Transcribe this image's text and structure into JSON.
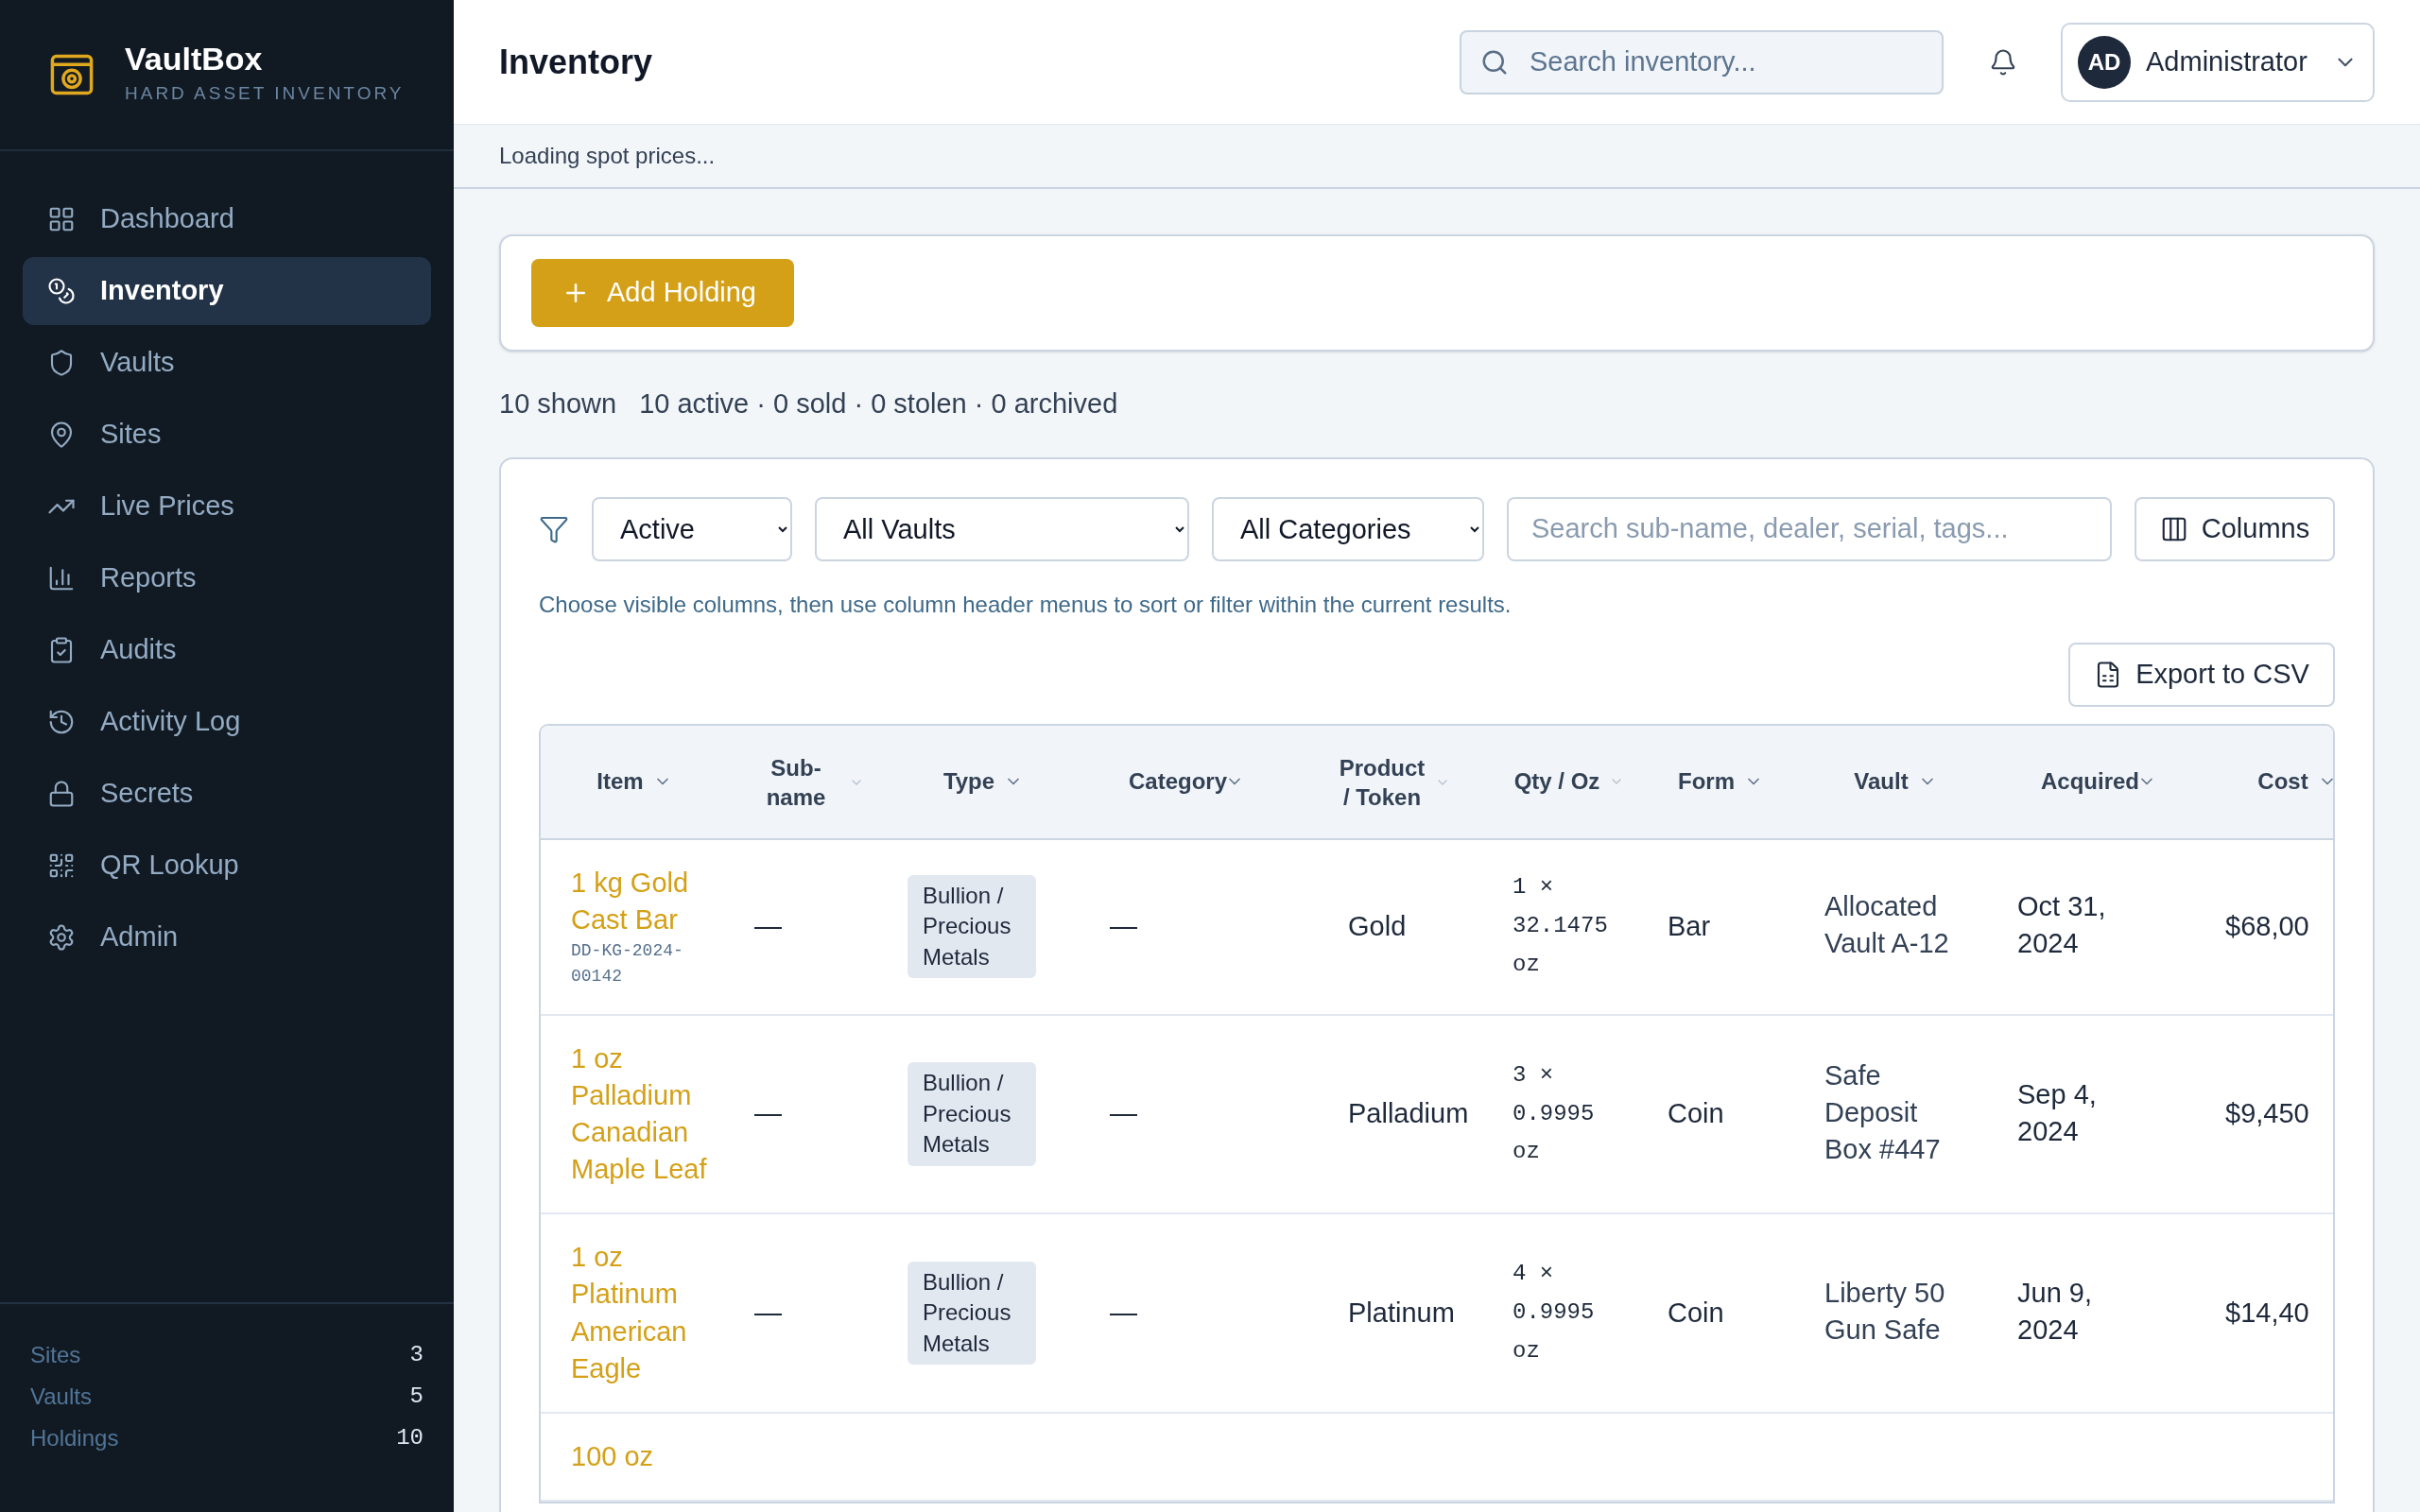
{
  "brand": {
    "name": "VaultBox",
    "subtitle": "HARD ASSET INVENTORY"
  },
  "nav": [
    {
      "label": "Dashboard",
      "selected": false
    },
    {
      "label": "Inventory",
      "selected": true
    },
    {
      "label": "Vaults",
      "selected": false
    },
    {
      "label": "Sites",
      "selected": false
    },
    {
      "label": "Live Prices",
      "selected": false
    },
    {
      "label": "Reports",
      "selected": false
    },
    {
      "label": "Audits",
      "selected": false
    },
    {
      "label": "Activity Log",
      "selected": false
    },
    {
      "label": "Secrets",
      "selected": false
    },
    {
      "label": "QR Lookup",
      "selected": false
    },
    {
      "label": "Admin",
      "selected": false
    }
  ],
  "sidebar_stats": [
    {
      "label": "Sites",
      "value": "3"
    },
    {
      "label": "Vaults",
      "value": "5"
    },
    {
      "label": "Holdings",
      "value": "10"
    }
  ],
  "header": {
    "title": "Inventory",
    "search_placeholder": "Search inventory...",
    "user": {
      "initials": "AD",
      "name": "Administrator"
    }
  },
  "status_message": "Loading spot prices...",
  "add_button": "Add Holding",
  "summary": {
    "shown": "10 shown",
    "counts": "10 active · 0 sold · 0 stolen · 0 archived"
  },
  "filters": {
    "status": "Active",
    "vault": "All Vaults",
    "category": "All Categories",
    "search_placeholder": "Search sub-name, dealer, serial, tags...",
    "columns_button": "Columns"
  },
  "hint": "Choose visible columns, then use column header menus to sort or filter within the current results.",
  "export_button": "Export to CSV",
  "table": {
    "columns": [
      "Item",
      "Sub-name",
      "Type",
      "Category",
      "Product / Token",
      "Qty / Oz",
      "Form",
      "Vault",
      "Acquired",
      "Cost"
    ],
    "rows": [
      {
        "item": "1 kg Gold Cast Bar",
        "serial": "DD-KG-2024-00142",
        "sub_name": "—",
        "type": "Bullion / Precious Metals",
        "category": "—",
        "product": "Gold",
        "qty": "1 × 32.1475 oz",
        "form": "Bar",
        "vault": "Allocated Vault A-12",
        "acquired": "Oct 31, 2024",
        "cost": "$68,00"
      },
      {
        "item": "1 oz Palladium Canadian Maple Leaf",
        "sub_name": "—",
        "type": "Bullion / Precious Metals",
        "category": "—",
        "product": "Palladium",
        "qty": "3 × 0.9995 oz",
        "form": "Coin",
        "vault": "Safe Deposit Box #447",
        "acquired": "Sep 4, 2024",
        "cost": "$9,450"
      },
      {
        "item": "1 oz Platinum American Eagle",
        "sub_name": "—",
        "type": "Bullion / Precious Metals",
        "category": "—",
        "product": "Platinum",
        "qty": "4 × 0.9995 oz",
        "form": "Coin",
        "vault": "Liberty 50 Gun Safe",
        "acquired": "Jun 9, 2024",
        "cost": "$14,40"
      },
      {
        "item": "100 oz"
      }
    ]
  }
}
